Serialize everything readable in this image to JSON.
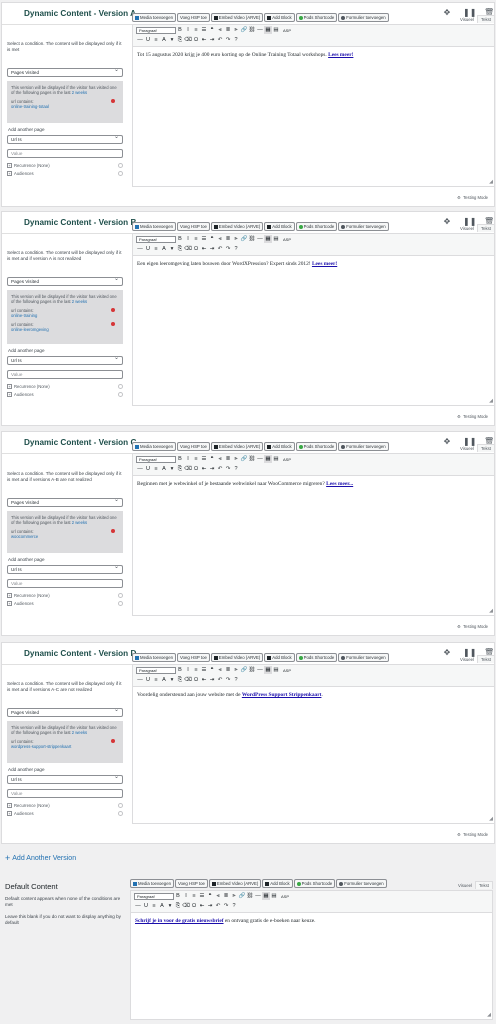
{
  "versions": [
    {
      "title": "Dynamic Content - Version A",
      "condition_text": "Select a condition. The content will be displayed only if it is met",
      "select_value": "Pages Visited",
      "info_text": "This version will be displayed if the visitor has visited one of the following pages in the last",
      "info_link": "2 weeks",
      "urls": [
        {
          "label": "url contains:",
          "value": "online-training-totaal"
        }
      ],
      "add_page_label": "Add another page",
      "operator_value": "Url Is",
      "value_placeholder": "Value",
      "recurrence_label": "Recurrence (None)",
      "audiences_label": "Audiences",
      "content_text": "Tot 15 augustus 2020 krijg je 400 euro korting op de Online Training Totaal workshops.",
      "content_link": "Lees meer!",
      "testing_label": "Testing Mode"
    },
    {
      "title": "Dynamic Content - Version B",
      "condition_text": "Select a condition. The content will be displayed only if it is met and if version A is not realized",
      "select_value": "Pages Visited",
      "info_text": "This version will be displayed if the visitor has visited one of the following pages in the last",
      "info_link": "2 weeks",
      "urls": [
        {
          "label": "url contains:",
          "value": "online-training"
        },
        {
          "label": "url contains:",
          "value": "online-leeromgeving"
        }
      ],
      "add_page_label": "Add another page",
      "operator_value": "Url Is",
      "value_placeholder": "Value",
      "recurrence_label": "Recurrence (None)",
      "audiences_label": "Audiences",
      "content_text": "Een eigen leeromgeving laten bouwen door WordXPression? Expert sinds 2012!",
      "content_link": "Lees meer!",
      "testing_label": "Testing Mode"
    },
    {
      "title": "Dynamic Content - Version C",
      "condition_text": "Select a condition. The content will be displayed only if it is met and if versions A-B are not realized",
      "select_value": "Pages Visited",
      "info_text": "This version will be displayed if the visitor has visited one of the following pages in the last",
      "info_link": "2 weeks",
      "urls": [
        {
          "label": "url contains:",
          "value": "woocommerce"
        }
      ],
      "add_page_label": "Add another page",
      "operator_value": "Url Is",
      "value_placeholder": "Value",
      "recurrence_label": "Recurrence (None)",
      "audiences_label": "Audiences",
      "content_text": "Beginnen met je webwinkel of je bestaande webwinkel naar WooCommerce migreren?",
      "content_link": "Lees meer...",
      "testing_label": "Testing Mode"
    },
    {
      "title": "Dynamic Content - Version D",
      "condition_text": "Select a condition. The content will be displayed only if it is met and if versions A-C are not realized",
      "select_value": "Pages Visited",
      "info_text": "This version will be displayed if the visitor has visited one of the following pages in the last",
      "info_link": "2 weeks",
      "urls": [
        {
          "label": "url contains:",
          "value": "wordpress-support-strippenkaart"
        }
      ],
      "add_page_label": "Add another page",
      "operator_value": "Url Is",
      "value_placeholder": "Value",
      "recurrence_label": "Recurrence (None)",
      "audiences_label": "Audiences",
      "content_text": "Voordelig ondersteund aan jouw website met de",
      "content_link": "WordPress Support Strippenkaart",
      "content_after": ".",
      "testing_label": "Testing Mode"
    }
  ],
  "add_version_label": "Add Another Version",
  "default": {
    "title": "Default Content",
    "desc1": "Default content appears when none of the conditions are met",
    "desc2": "Leave this blank if you do not want to display anything by default",
    "content_link": "Schrijf je in voor de gratis nieuwsbrief",
    "content_text": "en ontvang gratis de e-boeken naar keuze."
  },
  "media_buttons": {
    "media": "Media toevoegen",
    "hsp": "Voeg HSP toe",
    "embed": "Embed Video (ARVE)",
    "add_block": "Add Block",
    "pods": "Pods Shortcode",
    "form": "Formulier toevoegen"
  },
  "tabs": {
    "visual": "Visueel",
    "text": "Tekst"
  },
  "toolbar": {
    "format": "Paragraaf",
    "asp": "ASP"
  },
  "colors": {
    "title": "#1e4e4a",
    "link": "#2271b1",
    "remove": "#d63638"
  }
}
